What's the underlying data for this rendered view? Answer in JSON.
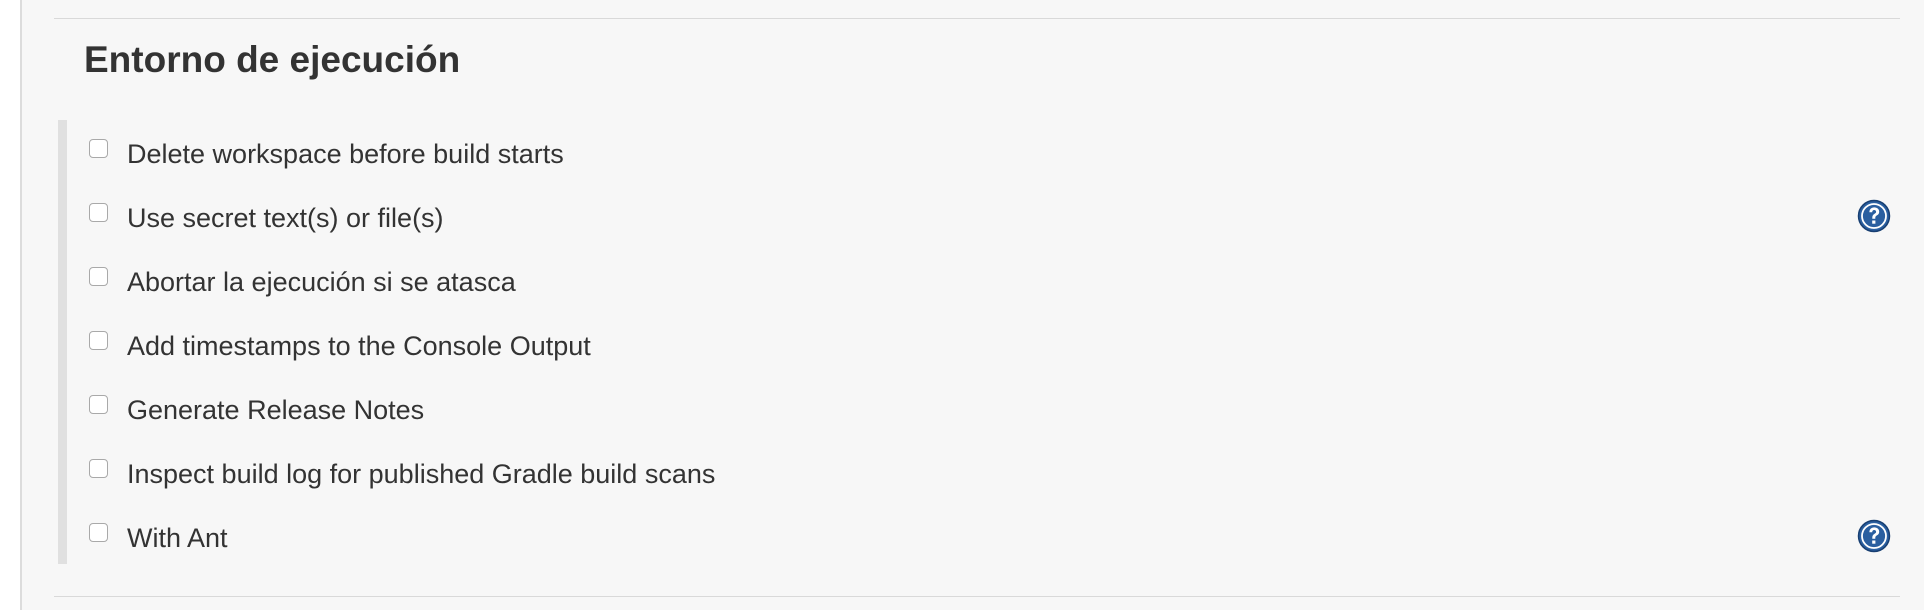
{
  "section": {
    "title": "Entorno de ejecución"
  },
  "options": [
    {
      "label": "Delete workspace before build starts",
      "checked": false,
      "has_help": false
    },
    {
      "label": "Use secret text(s) or file(s)",
      "checked": false,
      "has_help": true
    },
    {
      "label": "Abortar la ejecución si se atasca",
      "checked": false,
      "has_help": false
    },
    {
      "label": "Add timestamps to the Console Output",
      "checked": false,
      "has_help": false
    },
    {
      "label": "Generate Release Notes",
      "checked": false,
      "has_help": false
    },
    {
      "label": "Inspect build log for published Gradle build scans",
      "checked": false,
      "has_help": false
    },
    {
      "label": "With Ant",
      "checked": false,
      "has_help": true
    }
  ],
  "icons": {
    "help": "help-question-icon"
  },
  "colors": {
    "panel_background": "#f7f7f7",
    "text": "#333333",
    "help_icon_blue": "#2a5fa0"
  }
}
